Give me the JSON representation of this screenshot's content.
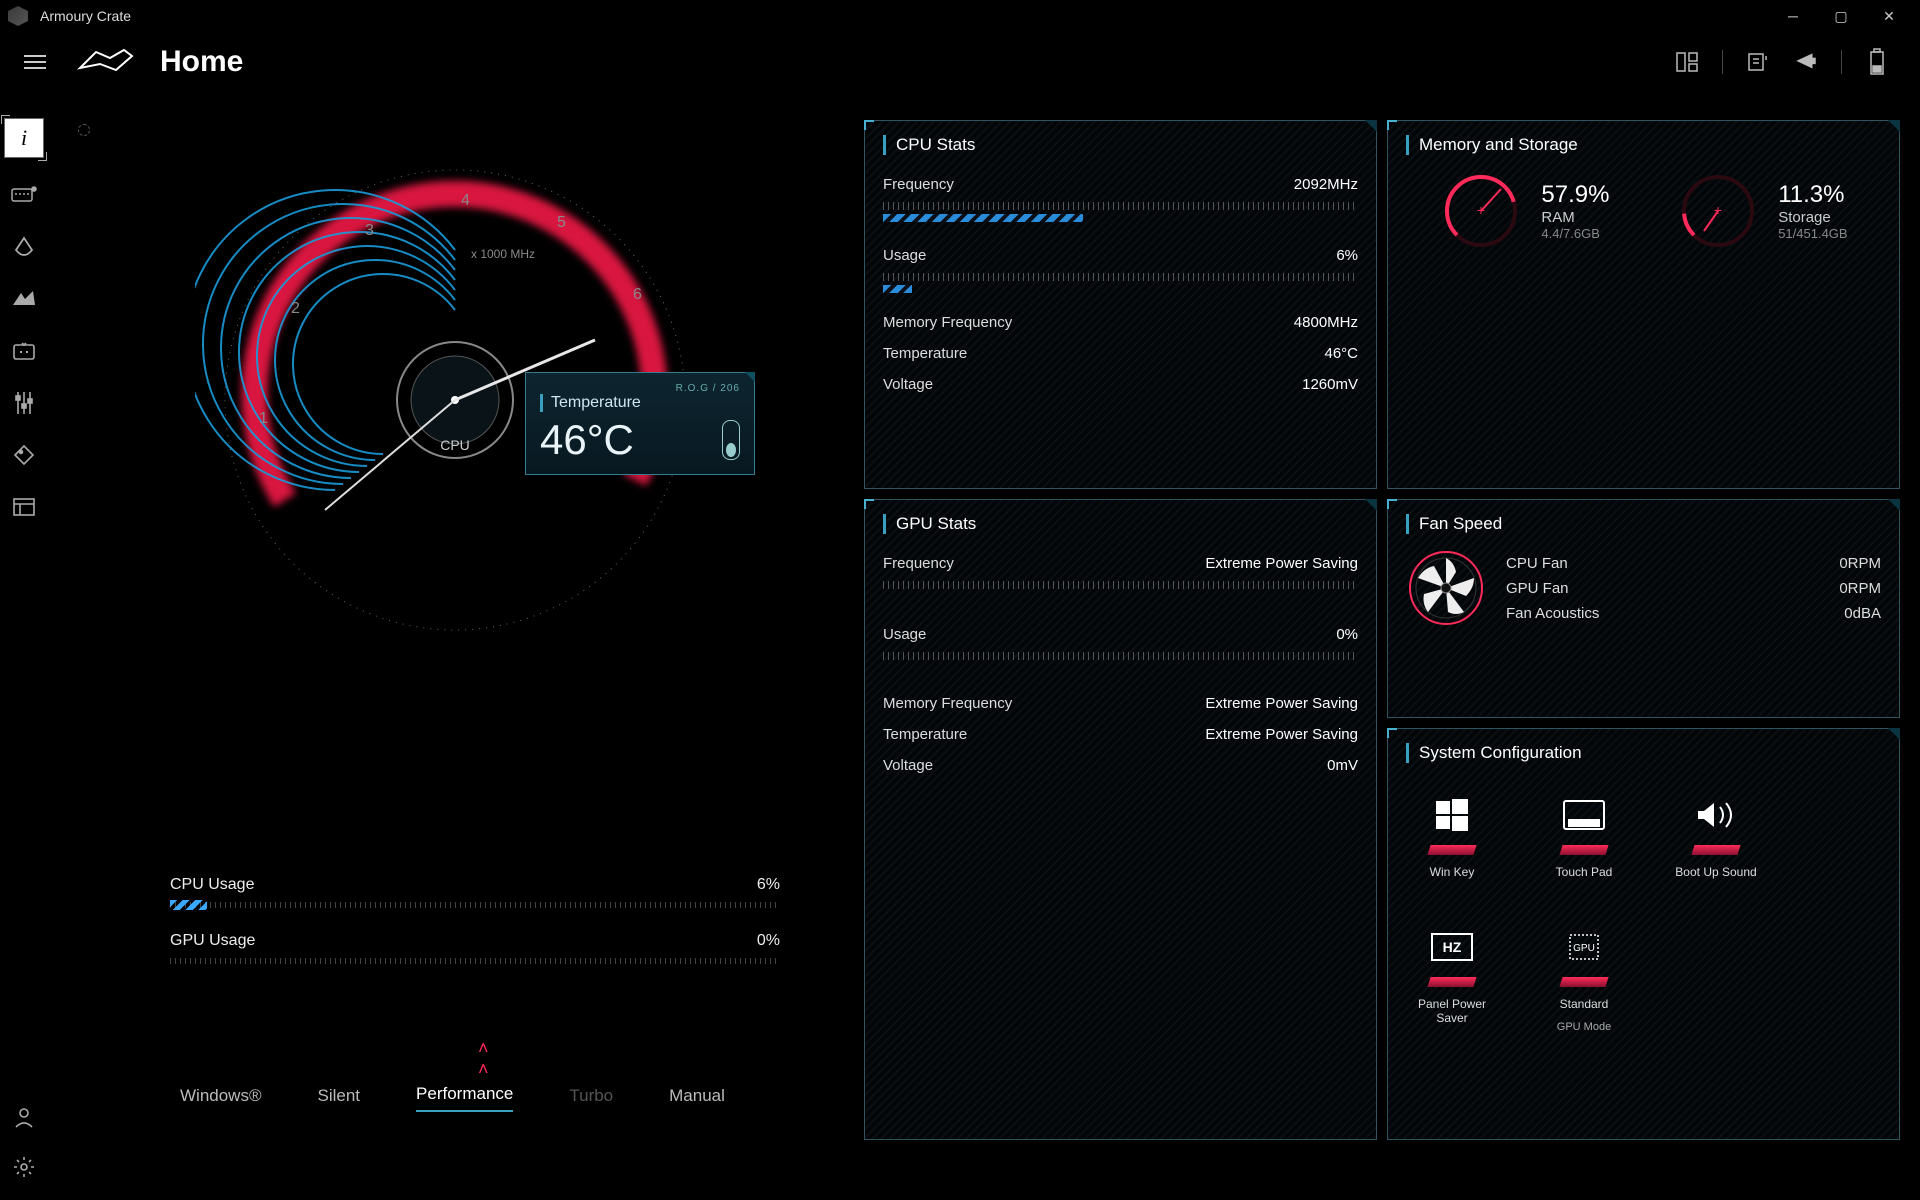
{
  "app": {
    "title": "Armoury Crate"
  },
  "page": {
    "title": "Home"
  },
  "gauge": {
    "scale_label": "x 1000 MHz",
    "small_text": "R.O.G / 206",
    "center_label": "CPU",
    "numbers": [
      "1",
      "2",
      "3",
      "4",
      "5",
      "6"
    ],
    "temp_label": "Temperature",
    "temp_value": "46°C"
  },
  "cpu_usage": {
    "label": "CPU Usage",
    "value": "6%",
    "pct": 6
  },
  "gpu_usage": {
    "label": "GPU Usage",
    "value": "0%",
    "pct": 0
  },
  "modes": {
    "items": [
      "Windows®",
      "Silent",
      "Performance",
      "Turbo",
      "Manual"
    ],
    "active_index": 2,
    "disabled_index": 3
  },
  "cpu_stats": {
    "title": "CPU Stats",
    "freq_label": "Frequency",
    "freq_value": "2092MHz",
    "freq_pct": 42,
    "usage_label": "Usage",
    "usage_value": "6%",
    "usage_pct": 6,
    "memfreq_label": "Memory Frequency",
    "memfreq_value": "4800MHz",
    "temp_label": "Temperature",
    "temp_value": "46°C",
    "volt_label": "Voltage",
    "volt_value": "1260mV"
  },
  "gpu_stats": {
    "title": "GPU Stats",
    "freq_label": "Frequency",
    "freq_value": "Extreme Power Saving",
    "usage_label": "Usage",
    "usage_value": "0%",
    "memfreq_label": "Memory Frequency",
    "memfreq_value": "Extreme Power Saving",
    "temp_label": "Temperature",
    "temp_value": "Extreme Power Saving",
    "volt_label": "Voltage",
    "volt_value": "0mV"
  },
  "memory": {
    "title": "Memory and Storage",
    "ram_pct": "57.9%",
    "ram_pct_num": 57.9,
    "ram_label": "RAM",
    "ram_sub": "4.4/7.6GB",
    "storage_pct": "11.3%",
    "storage_pct_num": 11.3,
    "storage_label": "Storage",
    "storage_sub": "51/451.4GB"
  },
  "fan": {
    "title": "Fan Speed",
    "rows": [
      {
        "label": "CPU Fan",
        "value": "0RPM"
      },
      {
        "label": "GPU Fan",
        "value": "0RPM"
      },
      {
        "label": "Fan Acoustics",
        "value": "0dBA"
      }
    ]
  },
  "sys": {
    "title": "System Configuration",
    "tiles": [
      {
        "label": "Win Key",
        "icon": "windows"
      },
      {
        "label": "Touch Pad",
        "icon": "touchpad"
      },
      {
        "label": "Boot Up Sound",
        "icon": "sound"
      },
      {
        "label": "Panel Power Saver",
        "icon": "hz"
      }
    ],
    "gpu_tile": {
      "top": "Standard",
      "bottom": "GPU Mode"
    }
  }
}
